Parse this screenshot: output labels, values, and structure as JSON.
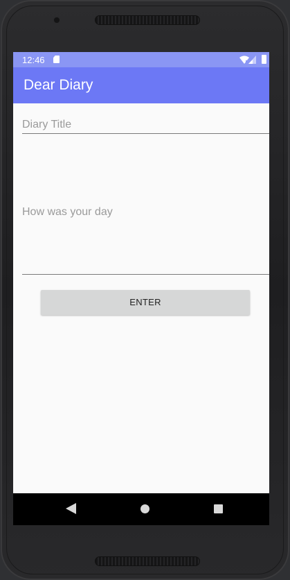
{
  "status_bar": {
    "time": "12:46",
    "background": "#8a96f4"
  },
  "app_bar": {
    "title": "Dear Diary",
    "background": "#6c78f5"
  },
  "form": {
    "title_field": {
      "placeholder": "Diary Title",
      "value": ""
    },
    "body_field": {
      "placeholder": "How was your day",
      "value": ""
    },
    "enter_button_label": "ENTER"
  },
  "icons": {
    "status": [
      "sd-card-icon",
      "wifi-icon",
      "signal-icon",
      "battery-icon"
    ],
    "navigation": [
      "back-icon",
      "home-icon",
      "recents-icon"
    ]
  }
}
